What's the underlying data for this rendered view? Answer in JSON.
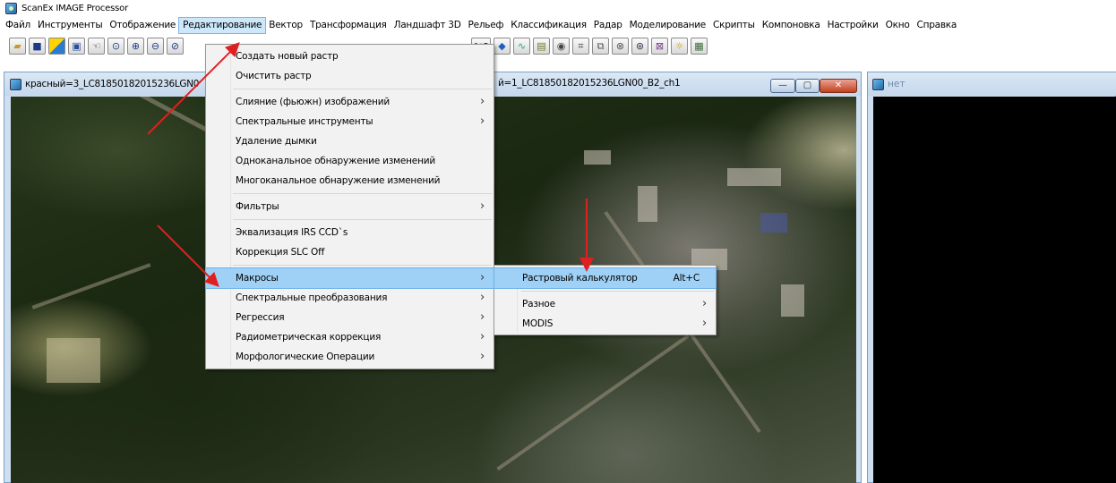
{
  "app": {
    "title": "ScanEx IMAGE Processor"
  },
  "menubar": {
    "items": [
      "Файл",
      "Инструменты",
      "Отображение",
      "Редактирование",
      "Вектор",
      "Трансформация",
      "Ландшафт 3D",
      "Рельеф",
      "Классификация",
      "Радар",
      "Моделирование",
      "Скрипты",
      "Компоновка",
      "Настройки",
      "Окно",
      "Справка"
    ],
    "active_item": "Редактирование"
  },
  "toolbar": {
    "left_icons": [
      "open-folder-icon",
      "save-icon",
      "palette-icon",
      "window-icon",
      "pan-hand-icon",
      "zoom-icon",
      "zoom-in-icon",
      "zoom-out-icon",
      "zoom-partial-icon"
    ],
    "right_icons": [
      "ab-calc-icon",
      "vector-edit-icon",
      "profile-icon",
      "table-icon",
      "object-icon",
      "grid-icon",
      "layers-icon",
      "target-icon",
      "zoom-target-icon",
      "zoom-box-icon",
      "brightness-icon",
      "spreadsheet-icon"
    ],
    "ab_label": "A+B"
  },
  "image_window": {
    "title_left": "красный=3_LC81850182015236LGN0",
    "title_right": "й=1_LC81850182015236LGN00_B2_ch1",
    "controls": {
      "minimize": "—",
      "maximize": "▢",
      "close": "✕"
    }
  },
  "right_panel": {
    "title": "нет"
  },
  "edit_menu": {
    "items": [
      {
        "label": "Создать новый растр",
        "has_submenu": false
      },
      {
        "label": "Очистить растр",
        "has_submenu": false
      },
      {
        "separator": true
      },
      {
        "label": "Слияние (фьюжн) изображений",
        "has_submenu": true
      },
      {
        "label": "Спектральные инструменты",
        "has_submenu": true
      },
      {
        "label": "Удаление дымки",
        "has_submenu": false
      },
      {
        "label": "Одноканальное обнаружение изменений",
        "has_submenu": false
      },
      {
        "label": "Многоканальное обнаружение изменений",
        "has_submenu": false
      },
      {
        "separator": true
      },
      {
        "label": "Фильтры",
        "has_submenu": true
      },
      {
        "separator": true
      },
      {
        "label": "Эквализация IRS CCD`s",
        "has_submenu": false
      },
      {
        "label": "Коррекция SLC Off",
        "has_submenu": false
      },
      {
        "separator": true
      },
      {
        "label": "Макросы",
        "has_submenu": true,
        "highlighted": true
      },
      {
        "label": "Спектральные преобразования",
        "has_submenu": true
      },
      {
        "label": "Регрессия",
        "has_submenu": true
      },
      {
        "label": "Радиометрическая коррекция",
        "has_submenu": true
      },
      {
        "label": "Морфологические Операции",
        "has_submenu": true
      }
    ]
  },
  "macros_submenu": {
    "items": [
      {
        "label": "Растровый калькулятор",
        "accelerator": "Alt+C",
        "highlighted": true
      },
      {
        "separator": true
      },
      {
        "label": "Разное",
        "has_submenu": true
      },
      {
        "label": "MODIS",
        "has_submenu": true
      }
    ]
  },
  "colors": {
    "annotation_arrow": "#e02020",
    "menu_highlight": "#9fd0f5",
    "menubar_active": "#cde8fb"
  }
}
